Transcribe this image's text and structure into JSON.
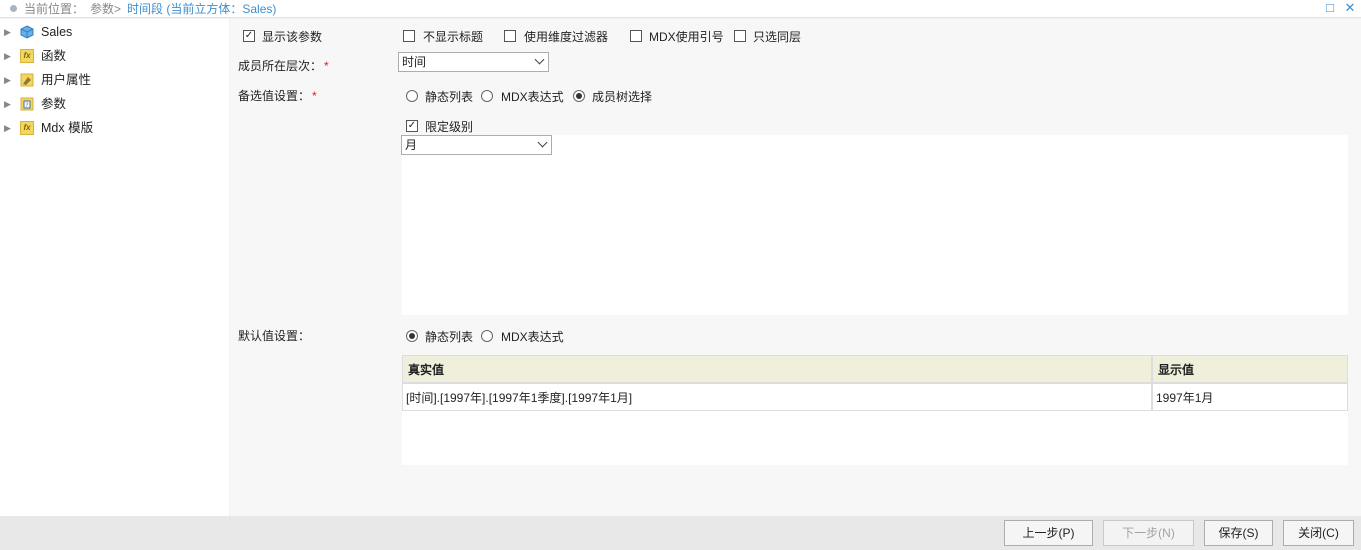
{
  "breadcrumb": {
    "prefix": "当前位置：",
    "item1": "参数>",
    "current": "时间段 (当前立方体：Sales)"
  },
  "window": {
    "maximize_icon": "maximize-icon",
    "close_icon": "close-icon",
    "maximize_glyph": "□",
    "close_glyph": "✕"
  },
  "sidebar": {
    "items": [
      {
        "label": "Sales",
        "icon": "cube-icon"
      },
      {
        "label": "函数",
        "icon": "function-icon"
      },
      {
        "label": "用户属性",
        "icon": "user-property-icon"
      },
      {
        "label": "参数",
        "icon": "parameter-icon"
      },
      {
        "label": "Mdx 模版",
        "icon": "mdx-template-icon"
      }
    ]
  },
  "form": {
    "show_param_label": "显示该参数",
    "hide_title_label": "不显示标题",
    "use_dim_filter_label": "使用维度过滤器",
    "mdx_quote_label": "MDX使用引号",
    "same_level_label": "只选同层",
    "member_level_label": "成员所在层次：",
    "member_level_value": "时间",
    "candidate_label": "备选值设置：",
    "candidate_options": [
      "静态列表",
      "MDX表达式",
      "成员树选择"
    ],
    "candidate_selected": "成员树选择",
    "limit_level_label": "限定级别",
    "limit_level_value": "月",
    "default_label": "默认值设置：",
    "default_options": [
      "静态列表",
      "MDX表达式"
    ],
    "default_selected": "静态列表",
    "required_mark": "*",
    "check_mark": "✓"
  },
  "grid": {
    "columns": [
      "真实值",
      "显示值"
    ],
    "rows": [
      [
        "[时间].[1997年].[1997年1季度].[1997年1月]",
        "1997年1月"
      ]
    ]
  },
  "footer": {
    "prev": "上一步(P)",
    "next": "下一步(N)",
    "save": "保存(S)",
    "close": "关闭(C)"
  }
}
